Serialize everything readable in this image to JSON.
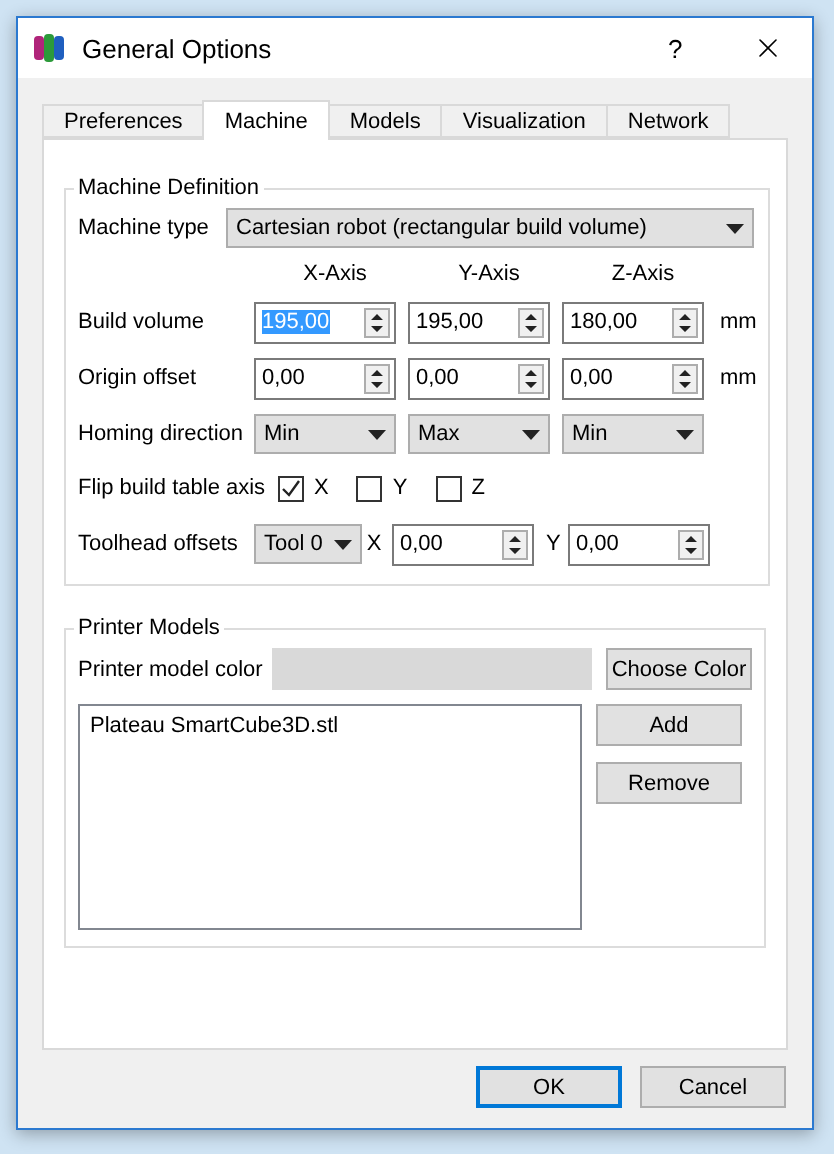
{
  "window": {
    "title": "General Options",
    "help": "?"
  },
  "tabs": [
    {
      "label": "Preferences",
      "selected": false
    },
    {
      "label": "Machine",
      "selected": true
    },
    {
      "label": "Models",
      "selected": false
    },
    {
      "label": "Visualization",
      "selected": false
    },
    {
      "label": "Network",
      "selected": false
    }
  ],
  "machine_definition": {
    "title": "Machine Definition",
    "machine_type": {
      "label": "Machine type",
      "value": "Cartesian robot (rectangular build volume)"
    },
    "axis_headers": [
      "X-Axis",
      "Y-Axis",
      "Z-Axis"
    ],
    "spin_rows": [
      {
        "label": "Build volume",
        "unit": "mm",
        "fields": [
          {
            "value": "195,00",
            "text_selected": true
          },
          {
            "value": "195,00",
            "text_selected": false
          },
          {
            "value": "180,00",
            "text_selected": false
          }
        ]
      },
      {
        "label": "Origin offset",
        "unit": "mm",
        "fields": [
          {
            "value": "0,00",
            "text_selected": false
          },
          {
            "value": "0,00",
            "text_selected": false
          },
          {
            "value": "0,00",
            "text_selected": false
          }
        ]
      }
    ],
    "homing_direction": {
      "label": "Homing direction",
      "values": [
        "Min",
        "Max",
        "Min"
      ]
    },
    "flip_axis": {
      "label": "Flip build table axis",
      "axes": [
        {
          "label": "X",
          "checked": true
        },
        {
          "label": "Y",
          "checked": false
        },
        {
          "label": "Z",
          "checked": false
        }
      ]
    },
    "toolhead_offsets": {
      "label": "Toolhead offsets",
      "tool": "Tool 0",
      "x_label": "X",
      "x_value": "0,00",
      "y_label": "Y",
      "y_value": "0,00"
    }
  },
  "printer_models": {
    "title": "Printer Models",
    "color_label": "Printer model color",
    "choose_color": "Choose Color",
    "models": [
      "Plateau SmartCube3D.stl"
    ],
    "buttons": [
      "Add",
      "Remove"
    ]
  },
  "buttons": [
    {
      "label": "OK",
      "default": true
    },
    {
      "label": "Cancel",
      "default": false
    }
  ]
}
